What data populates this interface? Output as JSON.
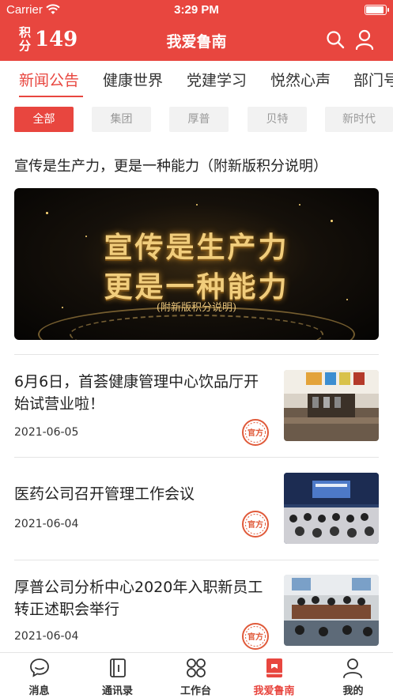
{
  "status_bar": {
    "carrier": "Carrier",
    "time": "3:29 PM"
  },
  "header": {
    "points_label": "积分",
    "points_value": "149",
    "title": "我爱鲁南",
    "search_icon": "search-icon",
    "user_icon": "user-icon"
  },
  "tabs": [
    {
      "label": "新闻公告",
      "active": true
    },
    {
      "label": "健康世界"
    },
    {
      "label": "党建学习"
    },
    {
      "label": "悦然心声"
    },
    {
      "label": "部门号"
    }
  ],
  "filters": [
    {
      "label": "全部",
      "active": true
    },
    {
      "label": "集团"
    },
    {
      "label": "厚普"
    },
    {
      "label": "贝特"
    },
    {
      "label": "新时代"
    }
  ],
  "featured": {
    "title": "宣传是生产力，更是一种能力（附新版积分说明）",
    "banner_line1": "宣传是生产力",
    "banner_line2": "更是一种能力",
    "banner_sub": "(附新版积分说明)"
  },
  "news": [
    {
      "title": "6月6日，首荟健康管理中心饮品厅开始试营业啦！",
      "date": "2021-06-05",
      "stamp": "官方"
    },
    {
      "title": "医药公司召开管理工作会议",
      "date": "2021-06-04",
      "stamp": "官方"
    },
    {
      "title": "厚普公司分析中心2020年入职新员工转正述职会举行",
      "date": "2021-06-04",
      "stamp": "官方"
    }
  ],
  "tabbar": [
    {
      "label": "消息",
      "icon": "message-icon"
    },
    {
      "label": "通讯录",
      "icon": "contacts-icon"
    },
    {
      "label": "工作台",
      "icon": "workbench-icon"
    },
    {
      "label": "我爱鲁南",
      "icon": "home-book-icon",
      "active": true
    },
    {
      "label": "我的",
      "icon": "profile-icon"
    }
  ],
  "colors": {
    "brand": "#e8463f",
    "stamp": "#e05a3a"
  }
}
